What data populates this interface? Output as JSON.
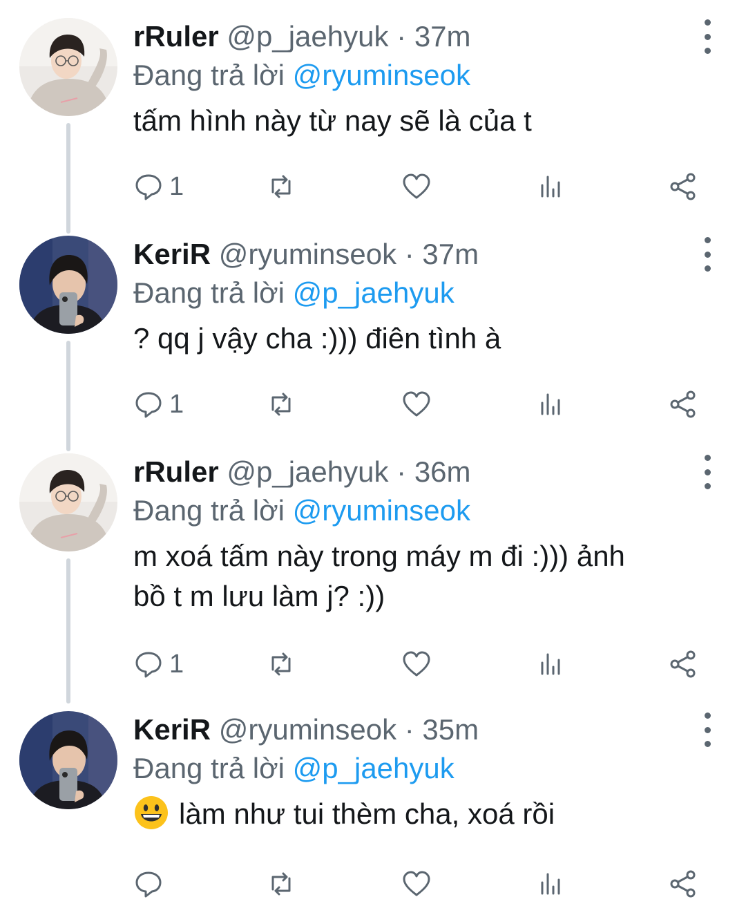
{
  "colors": {
    "text": "#14171a",
    "muted": "#5b6670",
    "mention": "#1d9bf0",
    "thread": "#d0d6dc"
  },
  "icons": [
    "reply-icon",
    "retweet-icon",
    "like-icon",
    "views-icon",
    "share-icon",
    "more-icon",
    "grinning-emoji"
  ],
  "tweets": [
    {
      "name": "rRuler",
      "handle": "@p_jaehyuk",
      "time": "· 37m",
      "reply_prefix": "Đang trả lời",
      "reply_to": "@ryuminseok",
      "text": "tấm hình này từ nay sẽ là của t",
      "reply_count": "1"
    },
    {
      "name": "KeriR",
      "handle": "@ryuminseok",
      "time": "· 37m",
      "reply_prefix": "Đang trả lời",
      "reply_to": "@p_jaehyuk",
      "text": "? qq j vậy cha :))) điên tình à",
      "reply_count": "1"
    },
    {
      "name": "rRuler",
      "handle": "@p_jaehyuk",
      "time": "· 36m",
      "reply_prefix": "Đang trả lời",
      "reply_to": "@ryuminseok",
      "text_line1": "m xoá tấm này trong máy m đi :))) ảnh",
      "text_line2": "bồ t m lưu làm j? :))",
      "reply_count": "1"
    },
    {
      "name": "KeriR",
      "handle": "@ryuminseok",
      "time": "· 35m",
      "reply_prefix": "Đang trả lời",
      "reply_to": "@p_jaehyuk",
      "text": "làm như tui thèm cha, xoá rồi",
      "reply_count": ""
    }
  ]
}
